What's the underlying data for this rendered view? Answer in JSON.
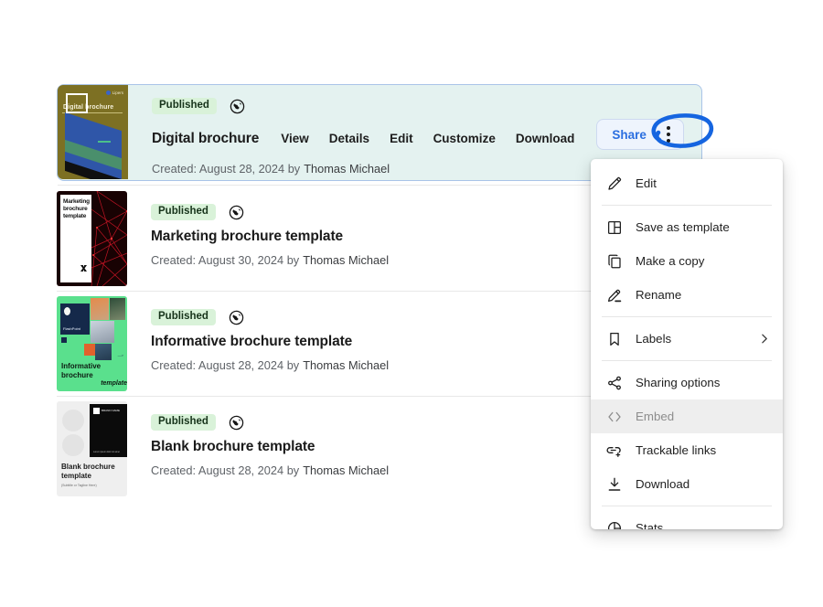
{
  "documents": [
    {
      "status": "Published",
      "visibility_icon": "globe-icon",
      "title": "Digital brochure",
      "created_prefix": "Created: August 28, 2024 by",
      "author": "Thomas Michael",
      "selected": true,
      "thumbnail_title": "Digital brochure",
      "thumbnail_badge": "Lipers",
      "actions": [
        "View",
        "Details",
        "Edit",
        "Customize",
        "Download"
      ],
      "share_label": "Share",
      "kebab_icon": "three-dots-vertical-icon"
    },
    {
      "status": "Published",
      "visibility_icon": "globe-icon",
      "title": "Marketing brochure template",
      "created_prefix": "Created: August 30, 2024 by",
      "author": "Thomas Michael",
      "selected": false,
      "thumbnail_title": "Marketing brochure template"
    },
    {
      "status": "Published",
      "visibility_icon": "globe-icon",
      "title": "Informative brochure template",
      "created_prefix": "Created: August 28, 2024 by",
      "author": "Thomas Michael",
      "selected": false,
      "thumbnail_title": "Informative brochure",
      "thumbnail_subtitle": "template"
    },
    {
      "status": "Published",
      "visibility_icon": "globe-icon",
      "title": "Blank brochure template",
      "created_prefix": "Created: August 28, 2024 by",
      "author": "Thomas Michael",
      "selected": false,
      "thumbnail_title": "Blank brochure template",
      "thumbnail_subtitle": "(Subtitle or Tagline Here)"
    }
  ],
  "context_menu": {
    "items": [
      {
        "label": "Edit",
        "icon": "pencil-icon",
        "hovered": false,
        "submenu": false
      },
      {
        "label": "Save as template",
        "icon": "template-layout-icon",
        "hovered": false,
        "submenu": false
      },
      {
        "label": "Make a copy",
        "icon": "copy-icon",
        "hovered": false,
        "submenu": false
      },
      {
        "label": "Rename",
        "icon": "rename-pencil-icon",
        "hovered": false,
        "submenu": false
      },
      {
        "label": "Labels",
        "icon": "bookmark-icon",
        "hovered": false,
        "submenu": true,
        "submenu_icon": "chevron-right-icon"
      },
      {
        "label": "Sharing options",
        "icon": "share-nodes-icon",
        "hovered": false,
        "submenu": false
      },
      {
        "label": "Embed",
        "icon": "code-brackets-icon",
        "hovered": true,
        "submenu": false
      },
      {
        "label": "Trackable links",
        "icon": "link-plus-icon",
        "hovered": false,
        "submenu": false
      },
      {
        "label": "Download",
        "icon": "download-icon",
        "hovered": false,
        "submenu": false
      },
      {
        "label": "Stats",
        "icon": "pie-chart-icon",
        "hovered": false,
        "submenu": false
      }
    ]
  },
  "annotation": {
    "shape": "hand-drawn-ellipse",
    "color": "#1565e0",
    "target": "three-dots-menu-button"
  },
  "colors": {
    "selected_row_bg": "#e4f2f0",
    "selected_row_border": "#a9c4e8",
    "status_pill_bg": "#d9f2d9",
    "status_pill_text": "#16331a",
    "share_text": "#2b6fe0",
    "menu_hover_bg": "#eeeeee",
    "page_bg": "#ffffff"
  }
}
